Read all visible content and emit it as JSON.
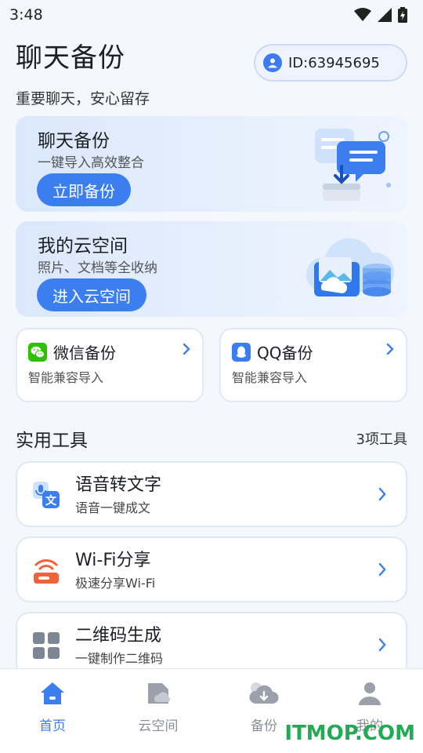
{
  "status_bar": {
    "time": "3:48"
  },
  "header": {
    "title": "聊天备份",
    "subtitle": "重要聊天，安心留存",
    "user_id": "ID:63945695"
  },
  "banners": [
    {
      "title": "聊天备份",
      "subtitle": "一键导入高效整合",
      "button": "立即备份"
    },
    {
      "title": "我的云空间",
      "subtitle": "照片、文档等全收纳",
      "button": "进入云空间"
    }
  ],
  "mini_cards": [
    {
      "title": "微信备份",
      "subtitle": "智能兼容导入",
      "icon": "wechat-icon"
    },
    {
      "title": "QQ备份",
      "subtitle": "智能兼容导入",
      "icon": "qq-icon"
    }
  ],
  "tools_section": {
    "title": "实用工具",
    "count": "3项工具"
  },
  "tools": [
    {
      "title": "语音转文字",
      "subtitle": "语音一键成文",
      "icon": "speech-to-text-icon"
    },
    {
      "title": "Wi-Fi分享",
      "subtitle": "极速分享Wi-Fi",
      "icon": "router-icon"
    },
    {
      "title": "二维码生成",
      "subtitle": "一键制作二维码",
      "icon": "qr-grid-icon"
    }
  ],
  "nav": [
    {
      "label": "首页",
      "icon": "home-icon",
      "active": true
    },
    {
      "label": "云空间",
      "icon": "cloud-folder-icon",
      "active": false
    },
    {
      "label": "备份",
      "icon": "cloud-download-icon",
      "active": false
    },
    {
      "label": "我的",
      "icon": "person-icon",
      "active": false
    }
  ],
  "watermark": "ITMOP.COM",
  "colors": {
    "accent": "#3b7ef0",
    "wechat": "#2dc100",
    "wifi": "#f0623a",
    "background": "#f4f8fd"
  }
}
